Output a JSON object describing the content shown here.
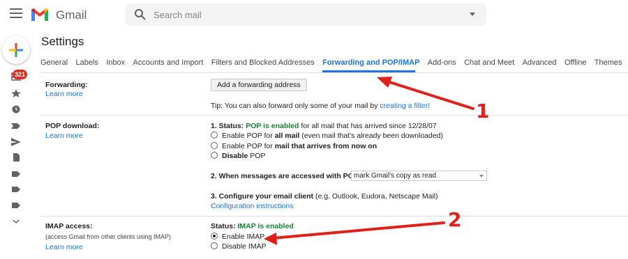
{
  "header": {
    "brand": "Gmail",
    "search_placeholder": "Search mail"
  },
  "rail": {
    "unread_count": "321"
  },
  "settings": {
    "title": "Settings",
    "tabs": [
      {
        "label": "General",
        "active": false
      },
      {
        "label": "Labels",
        "active": false
      },
      {
        "label": "Inbox",
        "active": false
      },
      {
        "label": "Accounts and Import",
        "active": false
      },
      {
        "label": "Filters and Blocked Addresses",
        "active": false
      },
      {
        "label": "Forwarding and POP/IMAP",
        "active": true
      },
      {
        "label": "Add-ons",
        "active": false
      },
      {
        "label": "Chat and Meet",
        "active": false
      },
      {
        "label": "Advanced",
        "active": false
      },
      {
        "label": "Offline",
        "active": false
      },
      {
        "label": "Themes",
        "active": false
      }
    ],
    "forwarding": {
      "label": "Forwarding:",
      "learn_more": "Learn more",
      "button": "Add a forwarding address",
      "tip_text": "Tip: You can also forward only some of your mail by ",
      "tip_link": "creating a filter!"
    },
    "pop": {
      "label": "POP download:",
      "learn_more": "Learn more",
      "status_prefix": "1. Status: ",
      "status_value": "POP is enabled",
      "status_suffix": " for all mail that has arrived since 12/28/07",
      "opt1_a": "Enable POP for ",
      "opt1_b": "all mail",
      "opt1_c": " (even mail that's already been downloaded)",
      "opt2_a": "Enable POP for ",
      "opt2_b": "mail that arrives from now on",
      "opt3_a": "Disable",
      "opt3_b": " POP",
      "when_label": "2. When messages are accessed with POP",
      "when_value": "mark Gmail's copy as read",
      "config_label": "3. Configure your email client",
      "config_hint": " (e.g. Outlook, Eudora, Netscape Mail)",
      "config_link": "Configuration instructions"
    },
    "imap": {
      "label": "IMAP access:",
      "sub": "(access Gmail from other clients using IMAP)",
      "learn_more": "Learn more",
      "status_prefix": "Status: ",
      "status_value": "IMAP is enabled",
      "opt_enable": "Enable IMAP",
      "opt_disable": "Disable IMAP"
    }
  },
  "annotations": {
    "one": "1",
    "two": "2",
    "color": "#e0201b"
  }
}
